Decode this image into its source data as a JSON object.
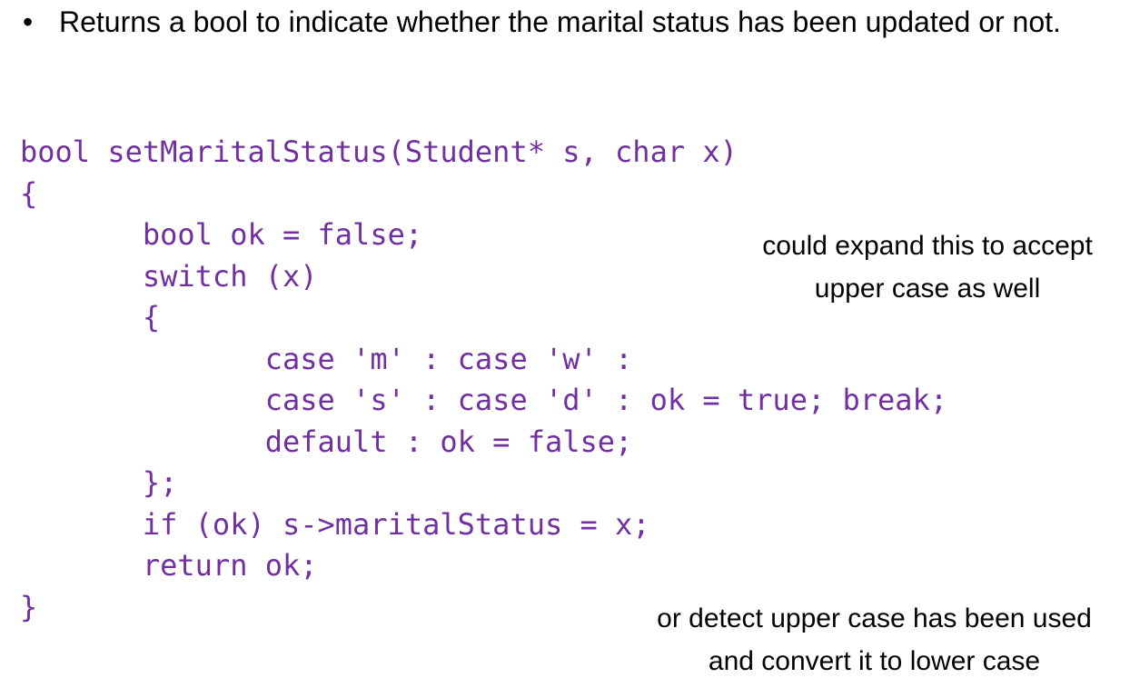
{
  "bullet": {
    "symbol": "•",
    "text": "Returns a bool to indicate whether the marital status has been updated or not."
  },
  "code": {
    "lines": [
      "bool setMaritalStatus(Student* s, char x)",
      "{",
      "       bool ok = false;",
      "       switch (x)",
      "       {",
      "              case 'm' : case 'w' :",
      "              case 's' : case 'd' : ok = true; break;",
      "              default : ok = false;",
      "       };",
      "       if (ok) s->maritalStatus = x;",
      "       return ok;",
      "}"
    ]
  },
  "notes": {
    "expand": {
      "line1": "could expand this to accept",
      "line2": "upper case as well"
    },
    "detect": {
      "line1": "or detect upper case has been used",
      "line2": "and convert it to lower case"
    }
  },
  "colors": {
    "code": "#7030A0",
    "text": "#000000",
    "background": "#FFFFFF"
  }
}
